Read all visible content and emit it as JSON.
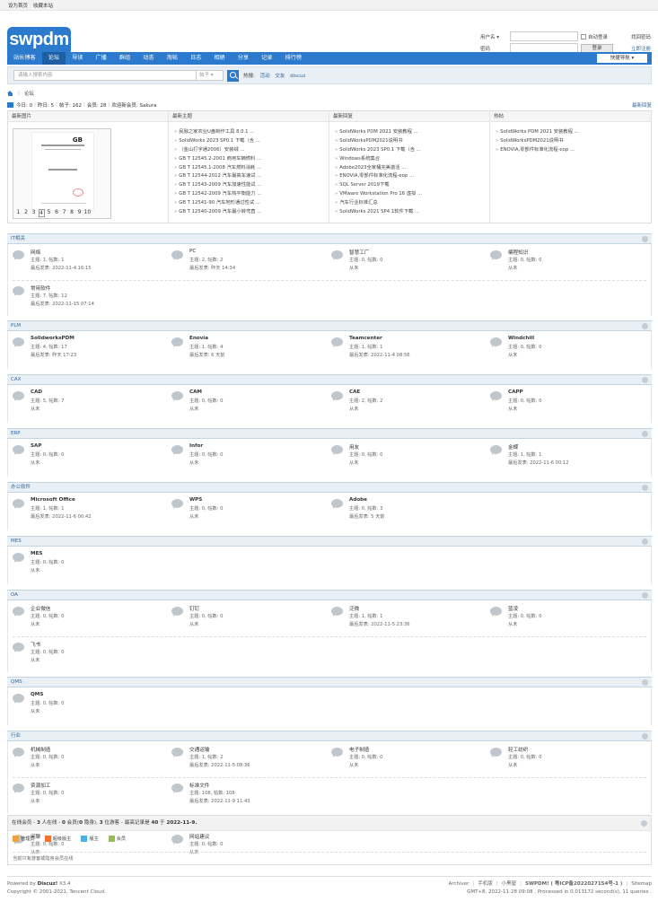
{
  "topbar": {
    "sethome": "设为首页",
    "favorite": "收藏本站"
  },
  "logo": {
    "text": "swpdm"
  },
  "login": {
    "username_label": "用户名",
    "auto_login": "自动登录",
    "forgot": "找回密码",
    "password_label": "密码",
    "login_button": "登录",
    "register": "立即注册"
  },
  "nav": {
    "items": [
      "站长博客",
      "论坛",
      "导读",
      "广播",
      "群组",
      "动态",
      "淘帖",
      "日志",
      "相册",
      "分享",
      "记录",
      "排行榜"
    ],
    "active": "论坛",
    "quick": "快捷导航"
  },
  "search": {
    "placeholder": "请输入搜索内容",
    "type": "帖子",
    "hot_label": "热搜:",
    "hot": [
      "活动",
      "交友",
      "discuz"
    ]
  },
  "breadcrumb": {
    "current": "论坛"
  },
  "stats": {
    "today": "今日: 0",
    "yesterday": "昨日: 5",
    "posts": "帖子: 162",
    "members": "会员: 28",
    "welcome": "欢迎新会员: Sakura",
    "latest": "最新回复"
  },
  "portal": {
    "headers": [
      "最新图片",
      "最新主题",
      "最新回复",
      "热帖"
    ],
    "pages": [
      "1",
      "2",
      "3",
      "4",
      "5",
      "6",
      "7",
      "8",
      "9",
      "10"
    ],
    "current_page": "4",
    "new_threads": [
      "民融之家农业U盘制作工具 8.0.1 ...",
      "SolidWorks 2023 SP0.1 下载（含 ...",
      "（金山打字通2006）安装绒 ...",
      "GB T 12545.2-2001 商用车辆燃料 ...",
      "GB T 12545.1-2008 汽车燃料消耗 ...",
      "GB T 12544-2012 汽车最高车速试 ...",
      "GB T 12543-2009 汽车加速性能试 ...",
      "GB T 12542-2009 汽车热平衡能力 ...",
      "GB T 12541-90 汽车地形通过性试 ...",
      "GB T 12540-2009 汽车最小转弯直 ..."
    ],
    "new_replies": [
      "SolidWorks PDM 2021 安装教程 ...",
      "SolidWorksPDM2021说明书",
      "SolidWorks 2023 SP0.1 下载（含 ...",
      "Windows系统集合",
      "Adobe2023全家桶完美激活 ...",
      "ENOVIA,零部件标准化流程-eop ...",
      "SQL Server 2019下载",
      "VMware Workstation Pro 16 虚拟 ...",
      "汽车行业标准汇总",
      "SolidWorks 2021 SP4.1软件下载 ..."
    ],
    "hot": [
      "SolidWorks PDM 2021 安装教程 ...",
      "SolidWorksPDM2021说明书",
      "ENOVIA,零部件标准化流程-eop ..."
    ]
  },
  "sections": [
    {
      "title": "IT相关",
      "forums": [
        {
          "name": "网络",
          "stats": "主题: 1, 帖数: 1",
          "last": "最后发表: 2022-11-4 16:15",
          "bold": false
        },
        {
          "name": "PC",
          "stats": "主题: 2, 帖数: 2",
          "last": "最后发表: 昨天 14:34",
          "bold": false
        },
        {
          "name": "智慧工厂",
          "stats": "主题: 0, 帖数: 0",
          "last": "从未",
          "bold": false
        },
        {
          "name": "编程知识",
          "stats": "主题: 0, 帖数: 0",
          "last": "从未",
          "bold": false
        },
        {
          "name": "常用软件",
          "stats": "主题: 7, 帖数: 12",
          "last": "最后发表: 2022-11-15 07:14",
          "bold": false
        }
      ]
    },
    {
      "title": "PLM",
      "forums": [
        {
          "name": "SolidworksPDM",
          "stats": "主题: 4, 帖数: 17",
          "last": "最后发表: 昨天 17:23",
          "bold": true
        },
        {
          "name": "Enovia",
          "stats": "主题: 1, 帖数: 4",
          "last": "最后发表: 6 天前",
          "bold": true
        },
        {
          "name": "Teamcenter",
          "stats": "主题: 1, 帖数: 1",
          "last": "最后发表: 2022-11-4 08:56",
          "bold": true
        },
        {
          "name": "Windchill",
          "stats": "主题: 0, 帖数: 0",
          "last": "从未",
          "bold": true
        }
      ]
    },
    {
      "title": "CAX",
      "forums": [
        {
          "name": "CAD",
          "stats": "主题: 5, 帖数: 7",
          "last": "从未",
          "bold": true
        },
        {
          "name": "CAM",
          "stats": "主题: 0, 帖数: 0",
          "last": "从未",
          "bold": true
        },
        {
          "name": "CAE",
          "stats": "主题: 2, 帖数: 2",
          "last": "从未",
          "bold": true
        },
        {
          "name": "CAPP",
          "stats": "主题: 0, 帖数: 0",
          "last": "从未",
          "bold": true
        }
      ]
    },
    {
      "title": "ERP",
      "forums": [
        {
          "name": "SAP",
          "stats": "主题: 0, 帖数: 0",
          "last": "从未",
          "bold": true
        },
        {
          "name": "Infor",
          "stats": "主题: 0, 帖数: 0",
          "last": "从未",
          "bold": true
        },
        {
          "name": "用友",
          "stats": "主题: 0, 帖数: 0",
          "last": "从未",
          "bold": false
        },
        {
          "name": "金蝶",
          "stats": "主题: 1, 帖数: 1",
          "last": "最后发表: 2022-11-6 00:12",
          "bold": false
        }
      ]
    },
    {
      "title": "办公软件",
      "forums": [
        {
          "name": "Microsoft Office",
          "stats": "主题: 1, 帖数: 1",
          "last": "最后发表: 2022-11-6 00:42",
          "bold": true
        },
        {
          "name": "WPS",
          "stats": "主题: 0, 帖数: 0",
          "last": "从未",
          "bold": true
        },
        {
          "name": "Adobe",
          "stats": "主题: 0, 帖数: 3",
          "last": "最后发表: 5 天前",
          "bold": true
        }
      ]
    },
    {
      "title": "MES",
      "forums": [
        {
          "name": "MES",
          "stats": "主题: 0, 帖数: 0",
          "last": "从未",
          "bold": true
        }
      ]
    },
    {
      "title": "OA",
      "forums": [
        {
          "name": "企业微信",
          "stats": "主题: 0, 帖数: 0",
          "last": "从未",
          "bold": false
        },
        {
          "name": "钉钉",
          "stats": "主题: 0, 帖数: 0",
          "last": "从未",
          "bold": false
        },
        {
          "name": "泛微",
          "stats": "主题: 1, 帖数: 1",
          "last": "最后发表: 2022-11-5 23:36",
          "bold": false
        },
        {
          "name": "蓝凌",
          "stats": "主题: 0, 帖数: 0",
          "last": "从未",
          "bold": false
        },
        {
          "name": "飞书",
          "stats": "主题: 0, 帖数: 0",
          "last": "从未",
          "bold": false
        }
      ]
    },
    {
      "title": "QMS",
      "forums": [
        {
          "name": "QMS",
          "stats": "主题: 0, 帖数: 0",
          "last": "从未",
          "bold": true
        }
      ]
    },
    {
      "title": "行业",
      "forums": [
        {
          "name": "机械制造",
          "stats": "主题: 0, 帖数: 0",
          "last": "从未",
          "bold": false
        },
        {
          "name": "交通运输",
          "stats": "主题: 1, 帖数: 2",
          "last": "最后发表: 2022-11-5 08:36",
          "bold": false
        },
        {
          "name": "电子制造",
          "stats": "主题: 0, 帖数: 0",
          "last": "从未",
          "bold": false
        },
        {
          "name": "轻工纺织",
          "stats": "主题: 0, 帖数: 0",
          "last": "从未",
          "bold": false
        },
        {
          "name": "资源加工",
          "stats": "主题: 0, 帖数: 0",
          "last": "从未",
          "bold": false
        },
        {
          "name": "标准文件",
          "stats": "主题: 108, 帖数: 108",
          "last": "最后发表: 2022-11-9 11:43",
          "bold": false
        }
      ]
    },
    {
      "title": "闲聊",
      "forums": [
        {
          "name": "闲聊",
          "stats": "主题: 0, 帖数: 0",
          "last": "从未",
          "bold": false
        },
        {
          "name": "网站建议",
          "stats": "主题: 0, 帖数: 0",
          "last": "从未",
          "bold": false
        }
      ]
    }
  ],
  "online": {
    "pre": "在线会员 - ",
    "total": "3",
    "mid1": " 人在线 - ",
    "members": "0",
    "mid2": " 会员(",
    "hidden": "0",
    "mid3": " 隐身), ",
    "guests": "3",
    "mid4": " 位游客 - 最高记录是 ",
    "record": "40",
    "mid5": " 于 ",
    "record_date": "2022-11-9.",
    "legend": [
      "管理员",
      "超级版主",
      "版主",
      "会员"
    ],
    "legend_colors": [
      "#f0a040",
      "#f07030",
      "#4ab0e0",
      "#8fc050"
    ],
    "none": "当前只有游客或隐身会员在线"
  },
  "footer": {
    "powered_label": "Powered by",
    "powered": "Discuz!",
    "version": "X3.4",
    "copyright": "Copyright © 2001-2021, Tencent Cloud.",
    "links": [
      "Archiver",
      "手机版",
      "小黑屋",
      "SWPDM! ( 粤ICP备2022027154号-1 )",
      "Sitemap"
    ],
    "time": "GMT+8, 2022-11-28 09:08 , Processed in 0.013172 second(s), 11 queries ."
  }
}
